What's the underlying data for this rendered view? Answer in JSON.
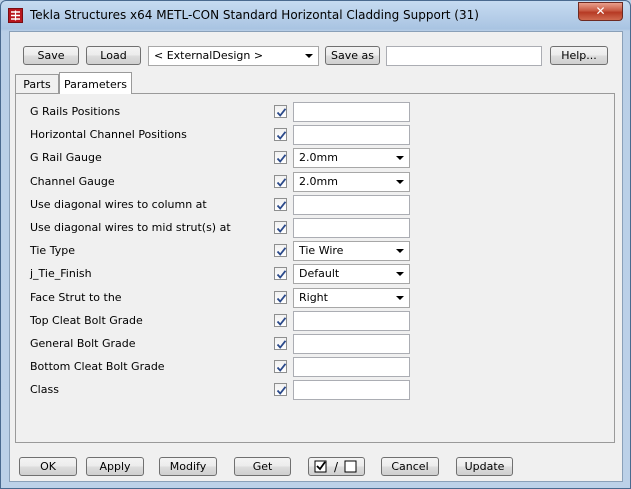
{
  "window": {
    "title": "Tekla Structures x64  METL-CON Standard Horizontal Cladding Support (31)",
    "close_label": "✕"
  },
  "toolbar": {
    "save_label": "Save",
    "load_label": "Load",
    "preset_value": "< ExternalDesign >",
    "save_as_label": "Save as",
    "save_as_value": "",
    "help_label": "Help..."
  },
  "tabs": [
    {
      "label": "Parts",
      "active": false
    },
    {
      "label": "Parameters",
      "active": true
    }
  ],
  "fields": [
    {
      "label": "G Rails Positions",
      "checked": true,
      "type": "text",
      "value": ""
    },
    {
      "label": "Horizontal Channel Positions",
      "checked": true,
      "type": "text",
      "value": ""
    },
    {
      "label": "G Rail Gauge",
      "checked": true,
      "type": "select",
      "value": "2.0mm"
    },
    {
      "label": "Channel Gauge",
      "checked": true,
      "type": "select",
      "value": "2.0mm"
    },
    {
      "label": "Use diagonal wires to column at",
      "checked": true,
      "type": "text",
      "value": ""
    },
    {
      "label": "Use diagonal wires to mid strut(s) at",
      "checked": true,
      "type": "text",
      "value": ""
    },
    {
      "label": "Tie Type",
      "checked": true,
      "type": "select",
      "value": "Tie Wire"
    },
    {
      "label": "j_Tie_Finish",
      "checked": true,
      "type": "select",
      "value": "Default"
    },
    {
      "label": "Face Strut to the",
      "checked": true,
      "type": "select",
      "value": "Right"
    },
    {
      "label": "Top Cleat Bolt Grade",
      "checked": true,
      "type": "text",
      "value": ""
    },
    {
      "label": "General Bolt Grade",
      "checked": true,
      "type": "text",
      "value": ""
    },
    {
      "label": "Bottom Cleat Bolt Grade",
      "checked": true,
      "type": "text",
      "value": ""
    },
    {
      "label": "Class",
      "checked": true,
      "type": "text",
      "value": ""
    }
  ],
  "footer": {
    "ok_label": "OK",
    "apply_label": "Apply",
    "modify_label": "Modify",
    "get_label": "Get",
    "toggle_label": "/",
    "cancel_label": "Cancel",
    "update_label": "Update"
  },
  "colors": {
    "title_gradient_top": "#c6dbf1",
    "dialog_bg": "#f0f0f0",
    "close_button": "#c85a43",
    "checkbox_check": "#2b4a8b"
  },
  "icons": {
    "app": "tekla-logo-icon",
    "close": "close-icon",
    "dropdown": "chevron-down-icon",
    "checkbox": "checkmark-icon"
  }
}
